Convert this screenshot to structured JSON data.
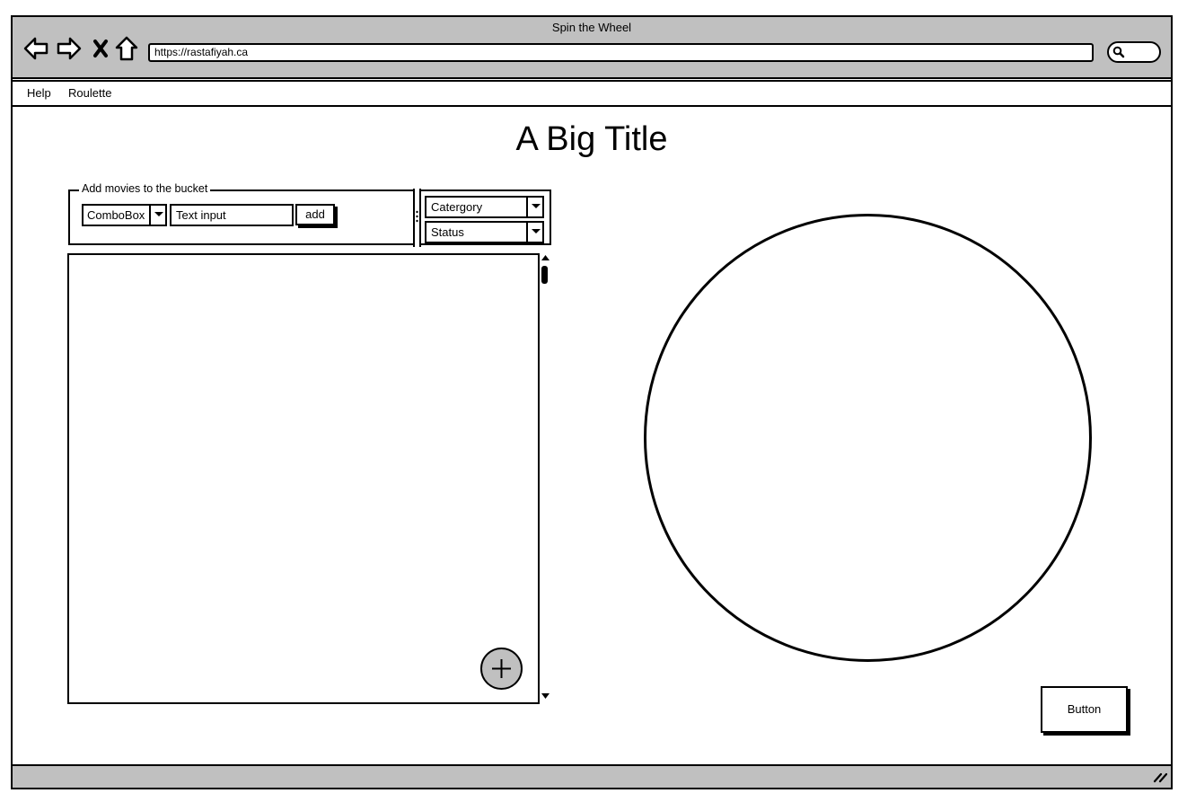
{
  "window": {
    "title": "Spin the Wheel",
    "url": "https://rastafiyah.ca",
    "nav_icons": [
      "back-arrow-icon",
      "forward-arrow-icon",
      "close-x-icon",
      "home-icon"
    ],
    "search_icon": "search-icon"
  },
  "menu": {
    "items": [
      {
        "label": "Help"
      },
      {
        "label": "Roulette"
      }
    ]
  },
  "page": {
    "title": "A Big Title"
  },
  "add_panel": {
    "legend": "Add movies to the bucket",
    "combobox_value": "ComboBox",
    "text_input_value": "Text input",
    "add_label": "add"
  },
  "filters": {
    "category": "Catergory",
    "status": "Status"
  },
  "list": {
    "fab_icon": "plus-icon"
  },
  "actions": {
    "button_label": "Button"
  },
  "colors": {
    "chrome": "#c0c0c0",
    "stroke": "#000000",
    "background": "#ffffff"
  }
}
